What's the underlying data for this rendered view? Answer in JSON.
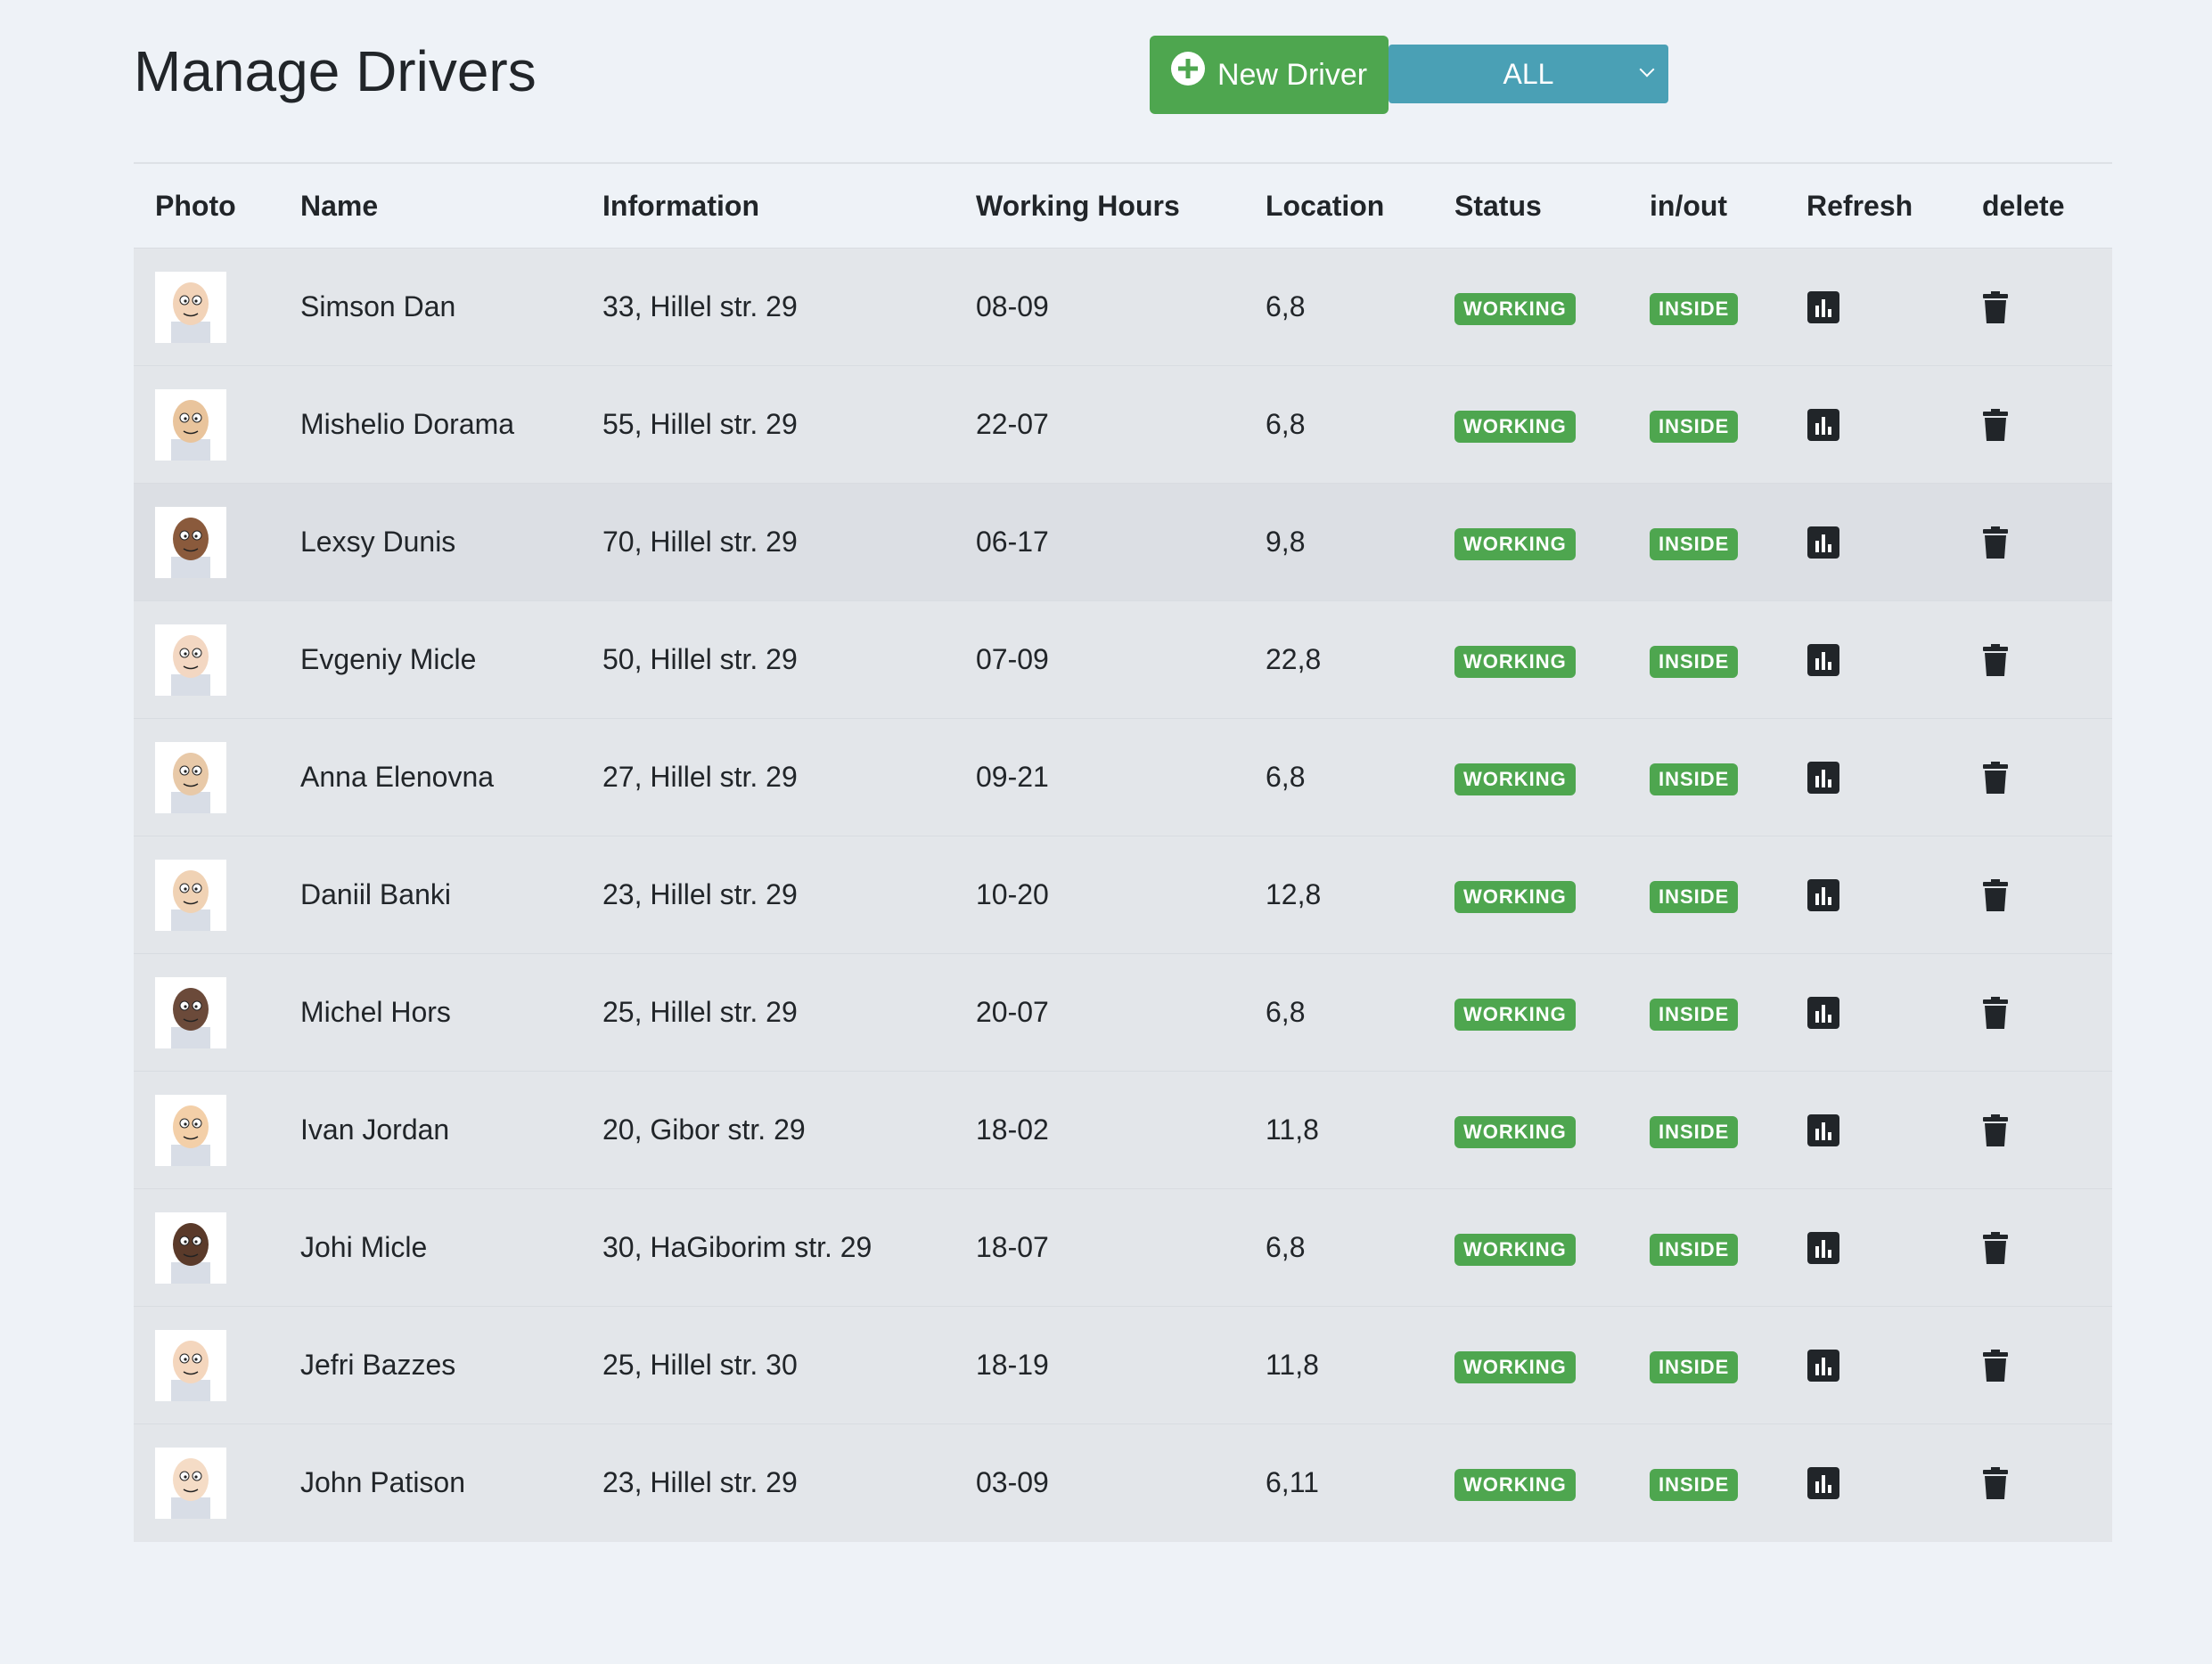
{
  "page": {
    "title": "Manage Drivers"
  },
  "toolbar": {
    "new_driver_label": "New Driver",
    "filter_value": "ALL"
  },
  "table": {
    "headers": [
      "Photo",
      "Name",
      "Information",
      "Working Hours",
      "Location",
      "Status",
      "in/out",
      "Refresh",
      "delete"
    ],
    "rows": [
      {
        "name": "Simson Dan",
        "information": "33, Hillel str. 29",
        "hours": "08-09",
        "location": "6,8",
        "status": "WORKING",
        "inout": "INSIDE"
      },
      {
        "name": "Mishelio Dorama",
        "information": "55, Hillel str. 29",
        "hours": "22-07",
        "location": "6,8",
        "status": "WORKING",
        "inout": "INSIDE"
      },
      {
        "name": "Lexsy Dunis",
        "information": "70, Hillel str. 29",
        "hours": "06-17",
        "location": "9,8",
        "status": "WORKING",
        "inout": "INSIDE"
      },
      {
        "name": "Evgeniy Micle",
        "information": "50, Hillel str. 29",
        "hours": "07-09",
        "location": "22,8",
        "status": "WORKING",
        "inout": "INSIDE"
      },
      {
        "name": "Anna Elenovna",
        "information": "27, Hillel str. 29",
        "hours": "09-21",
        "location": "6,8",
        "status": "WORKING",
        "inout": "INSIDE"
      },
      {
        "name": "Daniil Banki",
        "information": "23, Hillel str. 29",
        "hours": "10-20",
        "location": "12,8",
        "status": "WORKING",
        "inout": "INSIDE"
      },
      {
        "name": "Michel Hors",
        "information": "25, Hillel str. 29",
        "hours": "20-07",
        "location": "6,8",
        "status": "WORKING",
        "inout": "INSIDE"
      },
      {
        "name": "Ivan Jordan",
        "information": "20, Gibor str. 29",
        "hours": "18-02",
        "location": "11,8",
        "status": "WORKING",
        "inout": "INSIDE"
      },
      {
        "name": "Johi Micle",
        "information": "30, HaGiborim str. 29",
        "hours": "18-07",
        "location": "6,8",
        "status": "WORKING",
        "inout": "INSIDE"
      },
      {
        "name": "Jefri Bazzes",
        "information": "25, Hillel str. 30",
        "hours": "18-19",
        "location": "11,8",
        "status": "WORKING",
        "inout": "INSIDE"
      },
      {
        "name": "John Patison",
        "information": "23, Hillel str. 29",
        "hours": "03-09",
        "location": "6,11",
        "status": "WORKING",
        "inout": "INSIDE"
      }
    ]
  },
  "icons": {
    "new_driver": "plus-circle-icon",
    "filter": "chevron-down-icon",
    "refresh": "chart-icon",
    "delete": "trash-icon"
  },
  "colors": {
    "success": "#4ea64f",
    "info": "#4aa0b5",
    "background": "#eef2f7"
  }
}
